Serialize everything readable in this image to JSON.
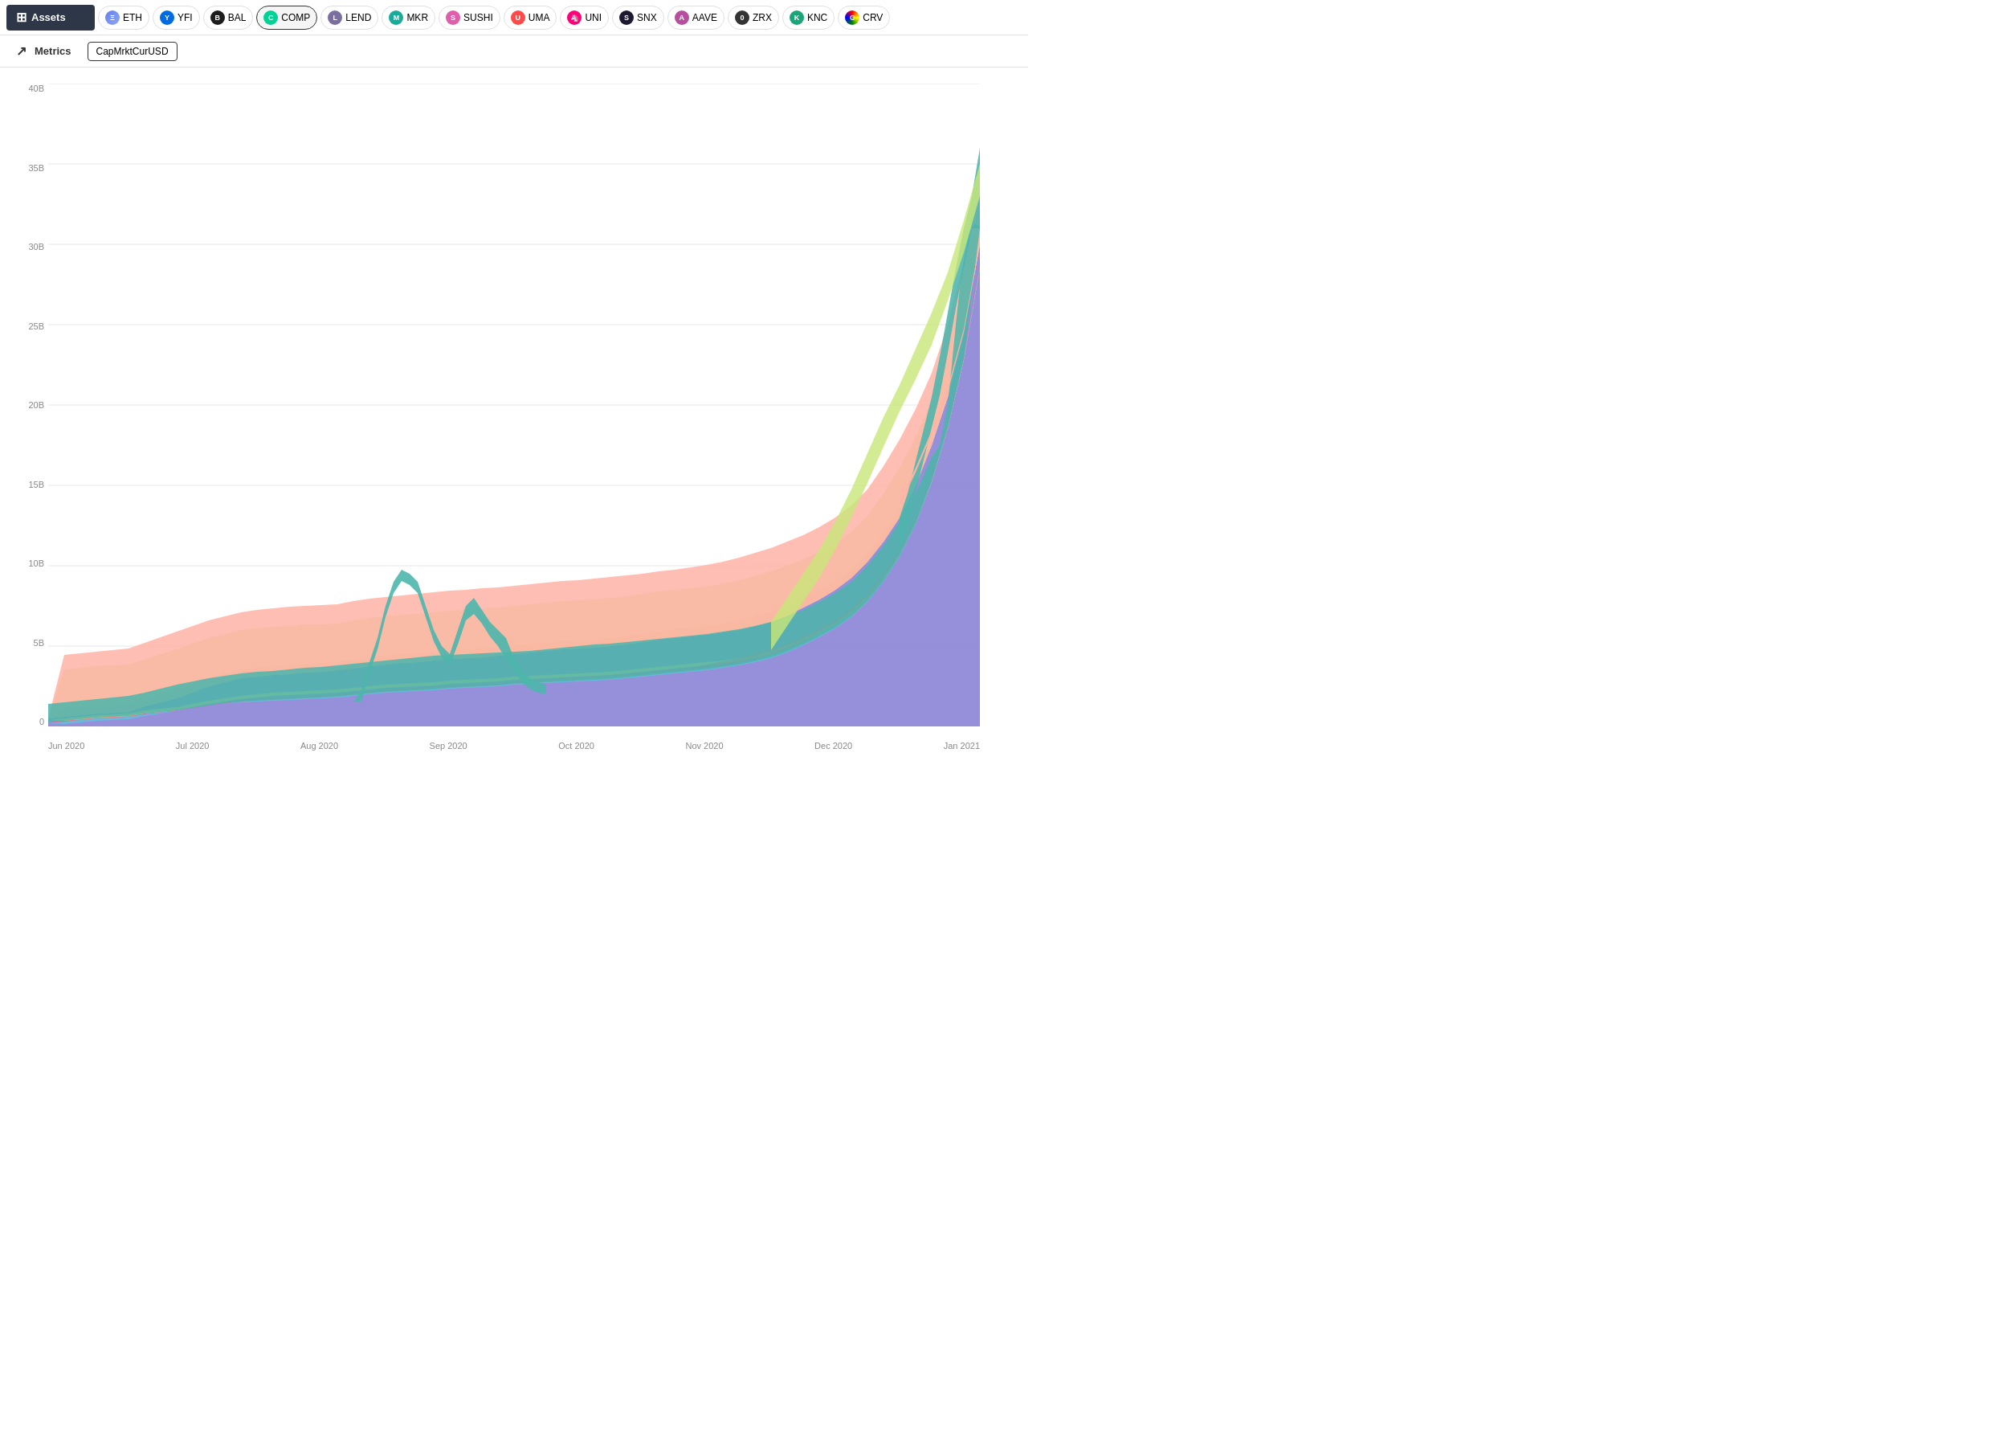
{
  "header": {
    "assets_label": "Assets",
    "metrics_label": "Metrics",
    "metric_tag": "CapMrktCurUSD"
  },
  "assets": [
    {
      "id": "eth",
      "label": "ETH",
      "color": "#627EEA",
      "text_color": "#fff"
    },
    {
      "id": "yfi",
      "label": "YFI",
      "color": "#006AE3",
      "text_color": "#fff"
    },
    {
      "id": "bal",
      "label": "BAL",
      "color": "#1d1d1d",
      "text_color": "#fff"
    },
    {
      "id": "comp",
      "label": "COMP",
      "color": "#00D395",
      "text_color": "#fff",
      "active": true
    },
    {
      "id": "lend",
      "label": "LEND",
      "color": "#7b6fa0",
      "text_color": "#fff"
    },
    {
      "id": "mkr",
      "label": "MKR",
      "color": "#1AAB9B",
      "text_color": "#fff"
    },
    {
      "id": "sushi",
      "label": "SUSHI",
      "color": "#E05DAA",
      "text_color": "#fff"
    },
    {
      "id": "uma",
      "label": "UMA",
      "color": "#FF4A4A",
      "text_color": "#fff"
    },
    {
      "id": "uni",
      "label": "UNI",
      "color": "#FF007A",
      "text_color": "#fff"
    },
    {
      "id": "snx",
      "label": "SNX",
      "color": "#1E1A31",
      "text_color": "#fff"
    },
    {
      "id": "aave",
      "label": "AAVE",
      "color": "#B6509E",
      "text_color": "#fff"
    },
    {
      "id": "zrx",
      "label": "ZRX",
      "color": "#333",
      "text_color": "#fff"
    },
    {
      "id": "knc",
      "label": "KNC",
      "color": "#1ba579",
      "text_color": "#fff"
    },
    {
      "id": "crv",
      "label": "CRV",
      "color": "#F5A623",
      "text_color": "#fff"
    }
  ],
  "y_axis": [
    "0",
    "5B",
    "10B",
    "15B",
    "20B",
    "25B",
    "30B",
    "35B",
    "40B"
  ],
  "x_axis": [
    "Jun 2020",
    "Jul 2020",
    "Aug 2020",
    "Sep 2020",
    "Oct 2020",
    "Nov 2020",
    "Dec 2020",
    "Jan 2021"
  ],
  "chart": {
    "colors": {
      "purple": "#7B68EE",
      "green_light": "#C8E6A0",
      "pink": "#FFB3A7",
      "teal": "#4DB6AC",
      "yellow": "#FFE082",
      "magenta": "#F48FB1",
      "cyan": "#80DEEA",
      "orange": "#FFAB76",
      "red_light": "#FF8A80"
    }
  }
}
